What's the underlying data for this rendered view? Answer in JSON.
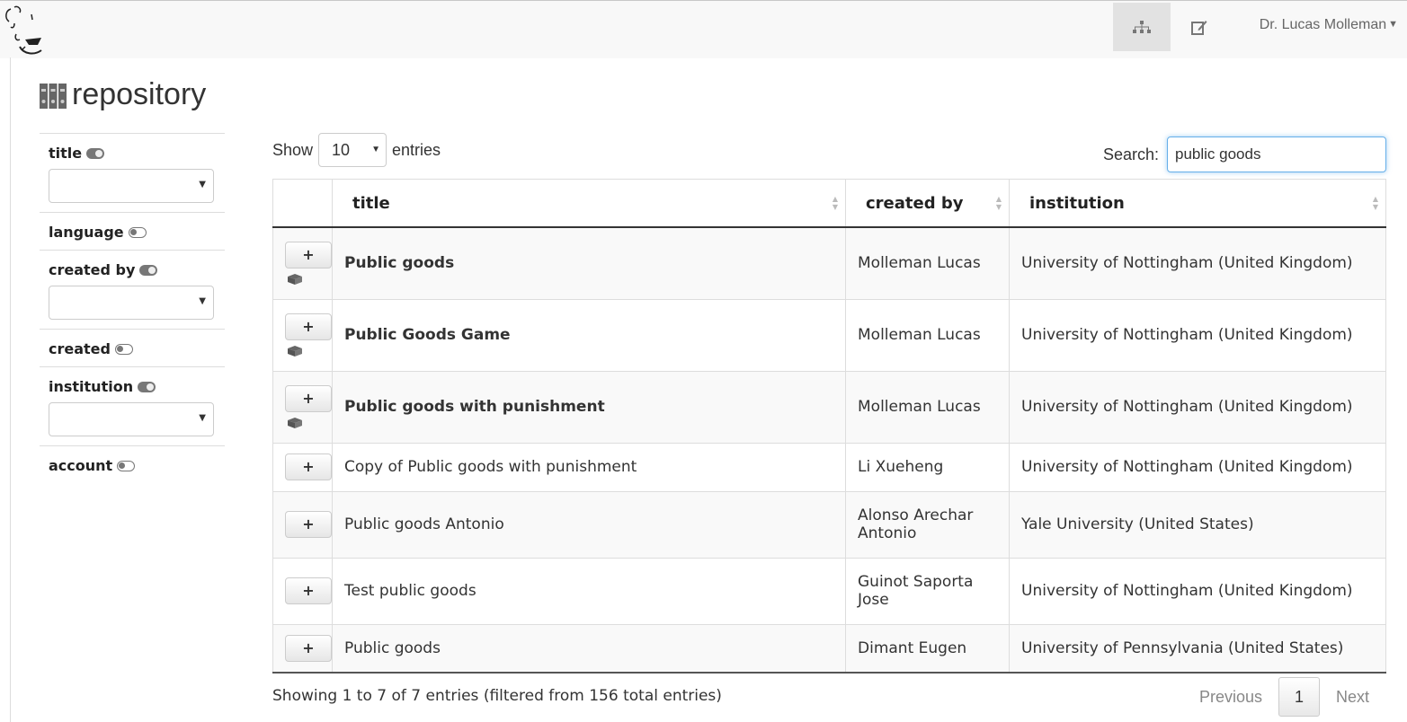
{
  "header": {
    "user_name": "Dr. Lucas Molleman"
  },
  "page": {
    "title": "repository"
  },
  "filters": [
    {
      "label": "title",
      "toggle": "on",
      "has_select": true
    },
    {
      "label": "language",
      "toggle": "off",
      "has_select": false
    },
    {
      "label": "created by",
      "toggle": "on",
      "has_select": true
    },
    {
      "label": "created",
      "toggle": "off",
      "has_select": false
    },
    {
      "label": "institution",
      "toggle": "on",
      "has_select": true
    },
    {
      "label": "account",
      "toggle": "off",
      "has_select": false
    }
  ],
  "table_controls": {
    "show_label": "Show",
    "page_length": "10",
    "entries_label": "entries",
    "search_label": "Search:",
    "search_value": "public goods"
  },
  "table": {
    "columns": [
      "title",
      "created by",
      "institution"
    ],
    "rows": [
      {
        "title": "Public goods",
        "created_by": "Molleman Lucas",
        "institution": "University of Nottingham (United Kingdom)",
        "bold": true,
        "has_box_icon": true,
        "add_label": "+"
      },
      {
        "title": "Public Goods Game",
        "created_by": "Molleman Lucas",
        "institution": "University of Nottingham (United Kingdom)",
        "bold": true,
        "has_box_icon": true,
        "add_label": "+"
      },
      {
        "title": "Public goods with punishment",
        "created_by": "Molleman Lucas",
        "institution": "University of Nottingham (United Kingdom)",
        "bold": true,
        "has_box_icon": true,
        "add_label": "+"
      },
      {
        "title": "Copy of Public goods with punishment",
        "created_by": "Li Xueheng",
        "institution": "University of Nottingham (United Kingdom)",
        "bold": false,
        "has_box_icon": false,
        "add_label": "+"
      },
      {
        "title": "Public goods Antonio",
        "created_by": "Alonso Arechar Antonio",
        "institution": "Yale University (United States)",
        "bold": false,
        "has_box_icon": false,
        "add_label": "+"
      },
      {
        "title": "Test public goods",
        "created_by": "Guinot Saporta Jose",
        "institution": "University of Nottingham (United Kingdom)",
        "bold": false,
        "has_box_icon": false,
        "add_label": "+"
      },
      {
        "title": "Public goods",
        "created_by": "Dimant Eugen",
        "institution": "University of Pennsylvania (United States)",
        "bold": false,
        "has_box_icon": false,
        "add_label": "+"
      }
    ]
  },
  "footer": {
    "info": "Showing 1 to 7 of 7 entries (filtered from 156 total entries)",
    "previous": "Previous",
    "current_page": "1",
    "next": "Next"
  }
}
